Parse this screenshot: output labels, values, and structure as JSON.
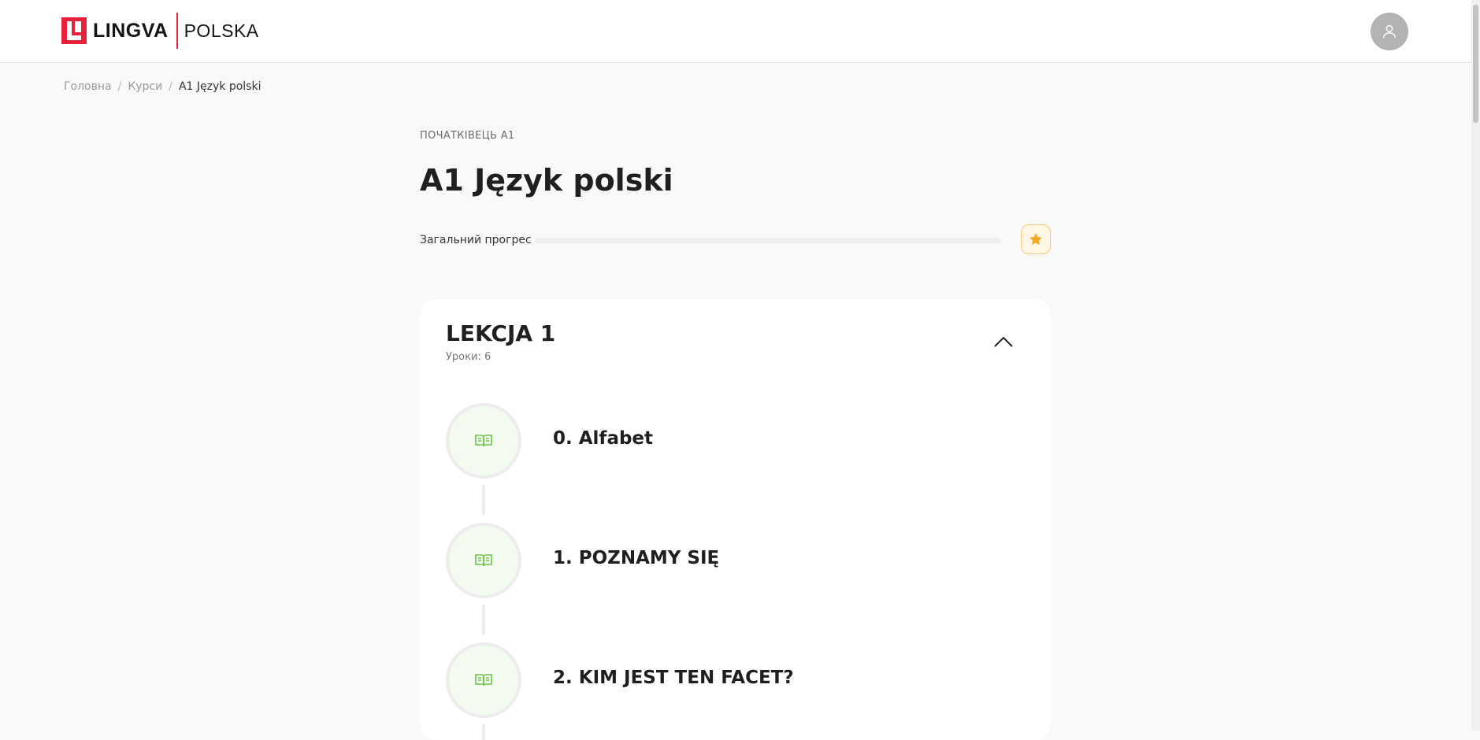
{
  "header": {
    "logo_word": "LINGVA",
    "logo_sub": "POLSKA",
    "avatar_icon": "user-icon"
  },
  "breadcrumb": {
    "items": [
      "Головна",
      "Курси",
      "A1 Język polski"
    ],
    "separator": "/"
  },
  "course": {
    "level": "ПОЧАТКІВЕЦЬ А1",
    "title": "A1 Język polski",
    "progress_label": "Загальний прогрес",
    "progress_percent": 0,
    "badge_icon": "star-icon"
  },
  "section": {
    "title": "LEKCJA 1",
    "lessons_count": "Уроки: 6",
    "toggle_icon": "chevron-up-icon",
    "lessons": [
      {
        "title": "0. Alfabet",
        "icon": "book-icon"
      },
      {
        "title": "1. POZNAMY SIĘ",
        "icon": "book-icon"
      },
      {
        "title": "2. KIM JEST TEN FACET?",
        "icon": "book-icon"
      }
    ]
  },
  "colors": {
    "brand_red": "#e8203a",
    "book_green": "#6cc24a",
    "star_orange": "#f5a623",
    "avatar_gray": "#b3b3b3"
  }
}
